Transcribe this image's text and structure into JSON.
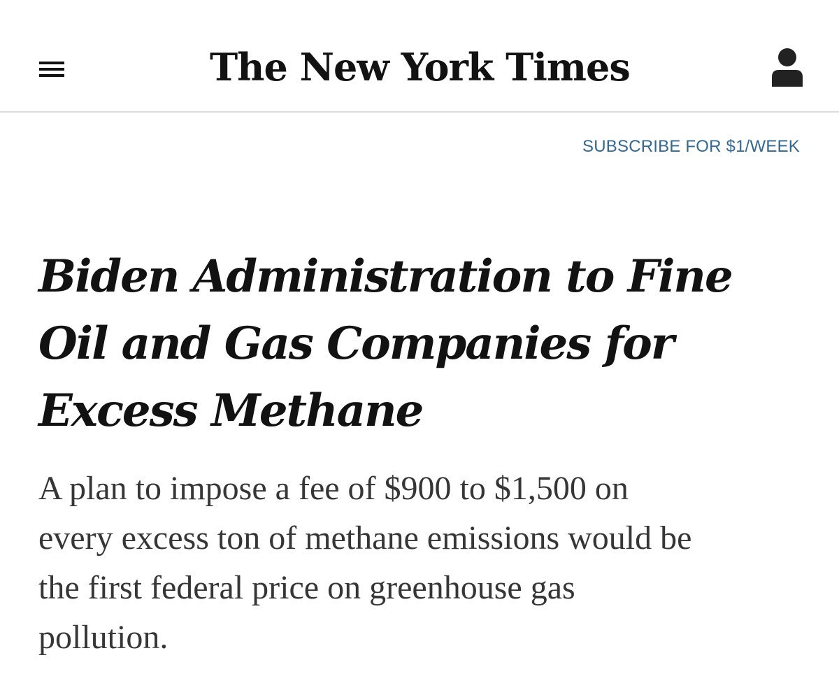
{
  "header": {
    "menu_icon": "hamburger-menu-icon",
    "logo_text": "The New York Times",
    "account_icon": "user-account-icon"
  },
  "subscribe": {
    "label": "SUBSCRIBE FOR $1/WEEK",
    "color": "#326891"
  },
  "article": {
    "headline_lines": [
      "Biden Administration to Fine",
      "Oil and Gas Companies for",
      "Excess Methane"
    ],
    "summary_lines": [
      "A plan to impose a fee of $900 to $1,500 on",
      "every excess ton of methane emissions would be",
      "the first federal price on greenhouse gas",
      "pollution."
    ]
  }
}
